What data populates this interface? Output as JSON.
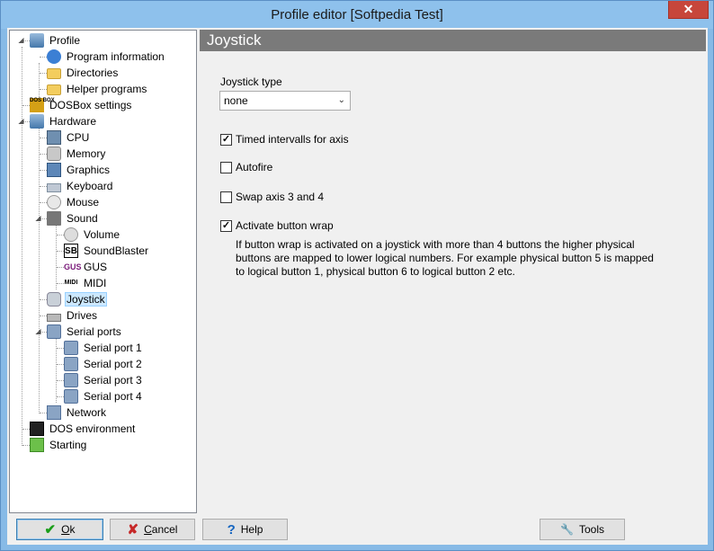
{
  "window": {
    "title": "Profile editor [Softpedia Test]",
    "close_label": "✕"
  },
  "tree": {
    "items": [
      {
        "label": "Profile",
        "icon": "profile-icon"
      },
      {
        "label": "Program information",
        "icon": "info-icon"
      },
      {
        "label": "Directories",
        "icon": "folder-icon"
      },
      {
        "label": "Helper programs",
        "icon": "helper-icon"
      },
      {
        "label": "DOSBox settings",
        "icon": "dosbox-icon"
      },
      {
        "label": "Hardware",
        "icon": "hardware-icon"
      },
      {
        "label": "CPU",
        "icon": "cpu-icon"
      },
      {
        "label": "Memory",
        "icon": "memory-icon"
      },
      {
        "label": "Graphics",
        "icon": "graphics-icon"
      },
      {
        "label": "Keyboard",
        "icon": "keyboard-icon"
      },
      {
        "label": "Mouse",
        "icon": "mouse-icon"
      },
      {
        "label": "Sound",
        "icon": "speaker-icon"
      },
      {
        "label": "Volume",
        "icon": "volume-icon"
      },
      {
        "label": "SoundBlaster",
        "icon": "soundblaster-icon"
      },
      {
        "label": "GUS",
        "icon": "gus-icon"
      },
      {
        "label": "MIDI",
        "icon": "midi-icon"
      },
      {
        "label": "Joystick",
        "icon": "joystick-icon"
      },
      {
        "label": "Drives",
        "icon": "drive-icon"
      },
      {
        "label": "Serial ports",
        "icon": "serial-icon"
      },
      {
        "label": "Serial port 1",
        "icon": "serial-icon"
      },
      {
        "label": "Serial port 2",
        "icon": "serial-icon"
      },
      {
        "label": "Serial port 3",
        "icon": "serial-icon"
      },
      {
        "label": "Serial port 4",
        "icon": "serial-icon"
      },
      {
        "label": "Network",
        "icon": "network-icon"
      },
      {
        "label": "DOS environment",
        "icon": "terminal-icon"
      },
      {
        "label": "Starting",
        "icon": "start-icon"
      }
    ],
    "icon_text": {
      "dosbox": "DOS BOX",
      "sb": "SB",
      "gus": "GUS",
      "midi": "MIDI"
    }
  },
  "panel": {
    "header": "Joystick",
    "joystick_type_label": "Joystick type",
    "joystick_type_value": "none",
    "checkboxes": [
      {
        "label": "Timed intervalls for axis",
        "checked": true,
        "mark": "✓"
      },
      {
        "label": "Autofire",
        "checked": false,
        "mark": ""
      },
      {
        "label": "Swap axis 3 and 4",
        "checked": false,
        "mark": ""
      },
      {
        "label": "Activate button wrap",
        "checked": true,
        "mark": "✓"
      }
    ],
    "description": "If button wrap is activated on a joystick with more than 4 buttons the higher physical buttons are mapped to lower logical numbers. For example physical button 5 is mapped to logical button 1, physical button 6 to logical button 2 etc."
  },
  "buttons": {
    "ok": {
      "accel": "O",
      "rest": "k",
      "icon": "✔"
    },
    "cancel": {
      "accel": "C",
      "rest": "ancel",
      "icon": "✘"
    },
    "help": {
      "label": "Help",
      "icon": "?"
    },
    "tools": {
      "label": "Tools",
      "icon": "🔧"
    }
  },
  "colors": {
    "ok_icon": "#1a9e1a",
    "cancel_icon": "#c62828",
    "help_icon": "#1565c0",
    "header_bg": "#7a7a7a"
  }
}
